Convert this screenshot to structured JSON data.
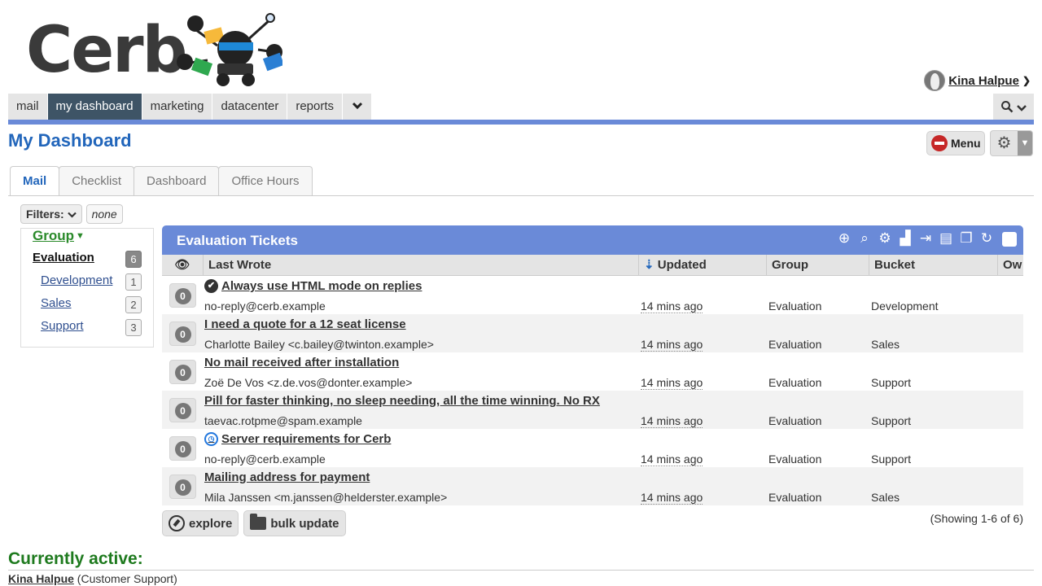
{
  "brand": {
    "logo_text": "Cerb"
  },
  "user": {
    "name": "Kina Halpue"
  },
  "topnav": {
    "tabs": [
      "mail",
      "my dashboard",
      "marketing",
      "datacenter",
      "reports"
    ],
    "active": "my dashboard"
  },
  "page": {
    "title": "My Dashboard",
    "menu_label": "Menu"
  },
  "subtabs": [
    "Mail",
    "Checklist",
    "Dashboard",
    "Office Hours"
  ],
  "filters": {
    "label": "Filters:",
    "value": "none"
  },
  "groups": {
    "heading": "Group",
    "items": [
      {
        "label": "Evaluation",
        "count": "6"
      },
      {
        "label": "Development",
        "count": "1"
      },
      {
        "label": "Sales",
        "count": "2"
      },
      {
        "label": "Support",
        "count": "3"
      }
    ]
  },
  "worklist": {
    "title": "Evaluation Tickets",
    "columns": {
      "last_wrote": "Last Wrote",
      "updated": "Updated",
      "group": "Group",
      "bucket": "Bucket",
      "owner": "Ow"
    },
    "rows": [
      {
        "count": "0",
        "subject": "Always use HTML mode on replies",
        "sender": "no-reply@cerb.example",
        "updated": "14 mins ago",
        "group": "Evaluation",
        "bucket": "Development"
      },
      {
        "count": "0",
        "subject": "I need a quote for a 12 seat license",
        "sender": "Charlotte Bailey <c.bailey@twinton.example>",
        "updated": "14 mins ago",
        "group": "Evaluation",
        "bucket": "Sales"
      },
      {
        "count": "0",
        "subject": "No mail received after installation",
        "sender": "Zoë De Vos <z.de.vos@donter.example>",
        "updated": "14 mins ago",
        "group": "Evaluation",
        "bucket": "Support"
      },
      {
        "count": "0",
        "subject": "Pill for faster thinking, no sleep needing, all the time winning. No RX",
        "sender": "taevac.rotpme@spam.example",
        "updated": "14 mins ago",
        "group": "Evaluation",
        "bucket": "Support"
      },
      {
        "count": "0",
        "subject": "Server requirements for Cerb",
        "sender": "no-reply@cerb.example",
        "updated": "14 mins ago",
        "group": "Evaluation",
        "bucket": "Support"
      },
      {
        "count": "0",
        "subject": "Mailing address for payment",
        "sender": "Mila Janssen <m.janssen@helderster.example>",
        "updated": "14 mins ago",
        "group": "Evaluation",
        "bucket": "Sales"
      }
    ],
    "explore_label": "explore",
    "bulk_label": "bulk update",
    "showing": "(Showing 1-6 of 6)"
  },
  "active": {
    "title": "Currently active:",
    "user": "Kina Halpue",
    "role": "(Customer Support)"
  },
  "colors": {
    "accent": "#6a8ad8",
    "nav_active": "#3e5466",
    "title_blue": "#2266bb",
    "active_green": "#1e7a1e"
  }
}
